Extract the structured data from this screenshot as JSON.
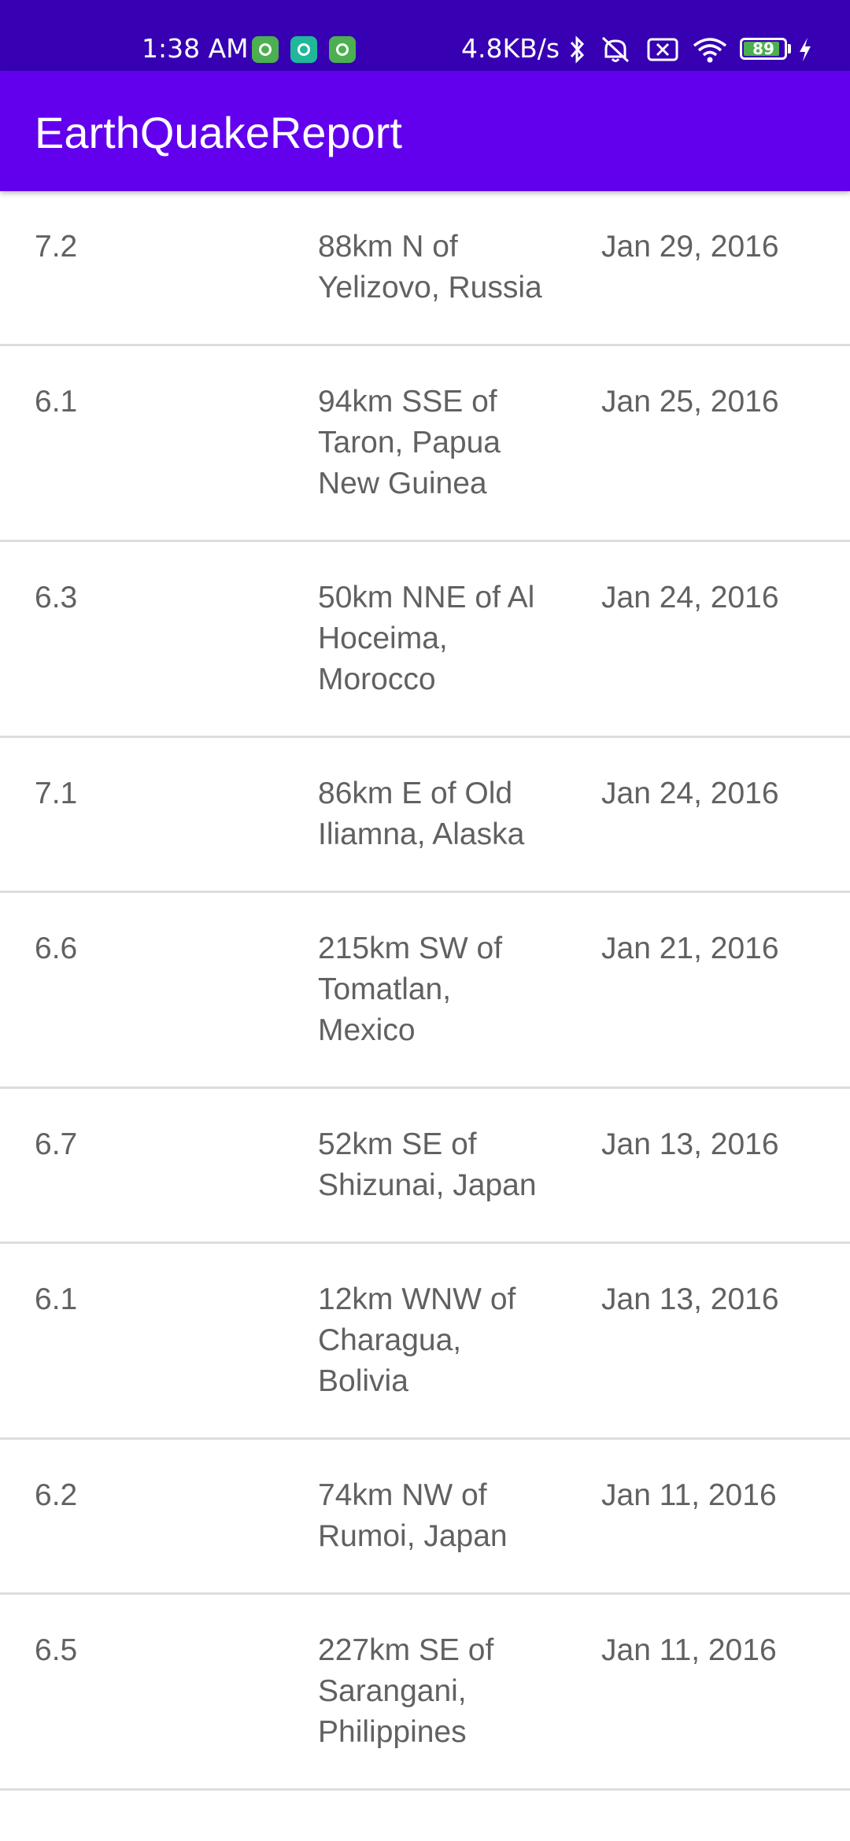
{
  "status_bar": {
    "time": "1:38 AM",
    "net_speed": "4.8KB/s",
    "battery": "89",
    "battery_level": 0.89,
    "icons": [
      "notification-app-icon",
      "vpn-shield-icon",
      "notification-app-icon",
      "bluetooth-icon",
      "mute-icon",
      "sim-x-icon",
      "wifi-icon",
      "battery-icon",
      "charging-icon"
    ]
  },
  "app_bar": {
    "title": "EarthQuakeReport",
    "color": "#6200EE",
    "status_color": "#3700B3"
  },
  "earthquakes": [
    {
      "magnitude": "7.2",
      "location": "88km N of Yelizovo, Russia",
      "date": "Jan 29, 2016"
    },
    {
      "magnitude": "6.1",
      "location": "94km SSE of Taron, Papua New Guinea",
      "date": "Jan 25, 2016"
    },
    {
      "magnitude": "6.3",
      "location": "50km NNE of Al Hoceima, Morocco",
      "date": "Jan 24, 2016"
    },
    {
      "magnitude": "7.1",
      "location": "86km E of Old Iliamna, Alaska",
      "date": "Jan 24, 2016"
    },
    {
      "magnitude": "6.6",
      "location": "215km SW of Tomatlan, Mexico",
      "date": "Jan 21, 2016"
    },
    {
      "magnitude": "6.7",
      "location": "52km SE of Shizunai, Japan",
      "date": "Jan 13, 2016"
    },
    {
      "magnitude": "6.1",
      "location": "12km WNW of Charagua, Bolivia",
      "date": "Jan 13, 2016"
    },
    {
      "magnitude": "6.2",
      "location": "74km NW of Rumoi, Japan",
      "date": "Jan 11, 2016"
    },
    {
      "magnitude": "6.5",
      "location": "227km SE of Sarangani, Philippines",
      "date": "Jan 11, 2016"
    }
  ]
}
